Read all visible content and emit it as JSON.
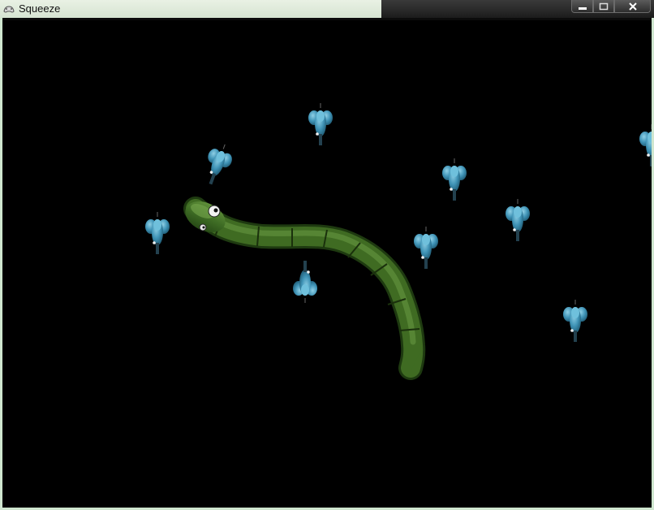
{
  "window": {
    "title": "Squeeze",
    "controls": {
      "minimize_icon": "minimize-icon",
      "maximize_icon": "maximize-icon",
      "close_icon": "close-icon"
    }
  },
  "game": {
    "background_color": "#000000",
    "snake_color": "#3d6b24",
    "mouse_color": "#4aa3c4"
  }
}
